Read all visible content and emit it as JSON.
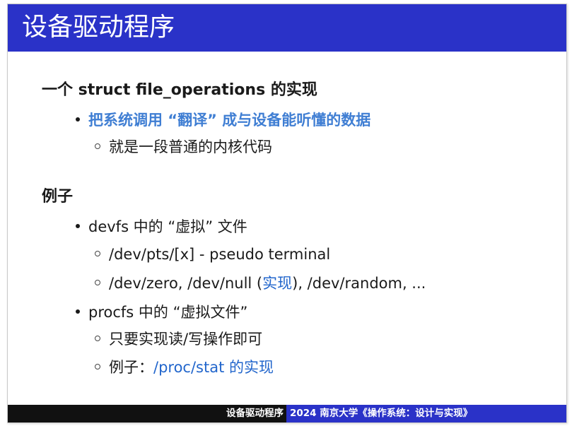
{
  "slide": {
    "title": "设备驱动程序",
    "section1": {
      "heading": "一个 struct file_operations 的实现",
      "bullet1": "把系统调用 “翻译” 成与设备能听懂的数据",
      "sub1": "就是一段普通的内核代码"
    },
    "section2": {
      "heading": "例子",
      "bullet1": "devfs 中的 “虚拟” 文件",
      "sub1": "/dev/pts/[x] - pseudo terminal",
      "sub2_prefix": "/dev/zero, /dev/null (",
      "sub2_link": "实现",
      "sub2_suffix": "), /dev/random, ...",
      "bullet2": "procfs 中的 “虚拟文件”",
      "sub3": "只要实现读/写操作即可",
      "sub4_prefix": "例子：",
      "sub4_link": "/proc/stat 的实现"
    },
    "footer": {
      "left": "设备驱动程序",
      "right": "2024 南京大学《操作系统：设计与实现》"
    },
    "colors": {
      "title_bar": "#2a32c8",
      "highlight": "#3f7ed3",
      "link": "#2266cc",
      "footer_left": "#111111"
    }
  }
}
